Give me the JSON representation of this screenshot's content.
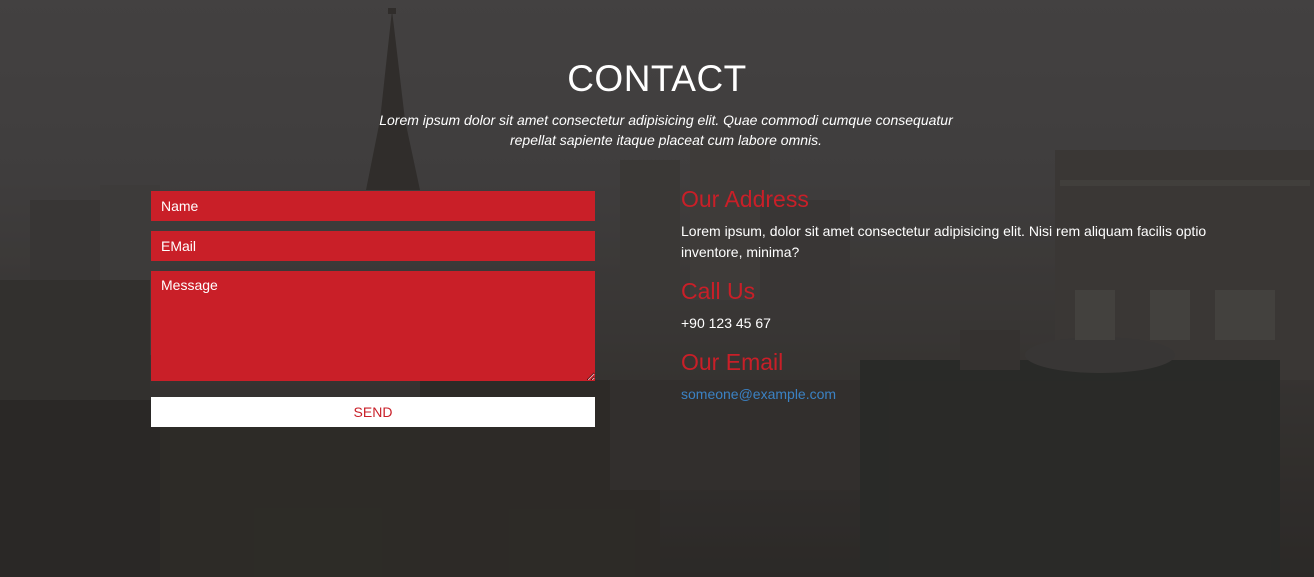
{
  "section": {
    "title": "CONTACT",
    "subtitle": "Lorem ipsum dolor sit amet consectetur adipisicing elit. Quae commodi cumque consequatur repellat sapiente itaque placeat cum labore omnis."
  },
  "form": {
    "name_placeholder": "Name",
    "email_placeholder": "EMail",
    "message_placeholder": "Message",
    "send_label": "SEND"
  },
  "contact_info": {
    "address_heading": "Our Address",
    "address_text": "Lorem ipsum, dolor sit amet consectetur adipisicing elit. Nisi rem aliquam facilis optio inventore, minima?",
    "phone_heading": "Call Us",
    "phone_text": "+90 123 45 67",
    "email_heading": "Our Email",
    "email_text": "someone@example.com"
  },
  "colors": {
    "accent": "#c91f28",
    "link": "#3b82c4",
    "text": "#ffffff"
  }
}
